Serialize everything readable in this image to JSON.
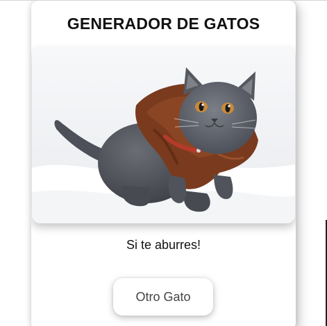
{
  "card": {
    "title": "GENERADOR DE GATOS",
    "image_alt": "",
    "subtitle": "Si te aburres!",
    "button_label": "Otro Gato"
  },
  "colors": {
    "background": "#ffffff",
    "title_text": "#111111",
    "button_text": "#444444",
    "cat_fur": "#5d6068",
    "cat_eyes": "#c98a3a",
    "sweater": "#7a3a1e",
    "collar": "#b63a2a",
    "snow": "#f2f3f5"
  }
}
